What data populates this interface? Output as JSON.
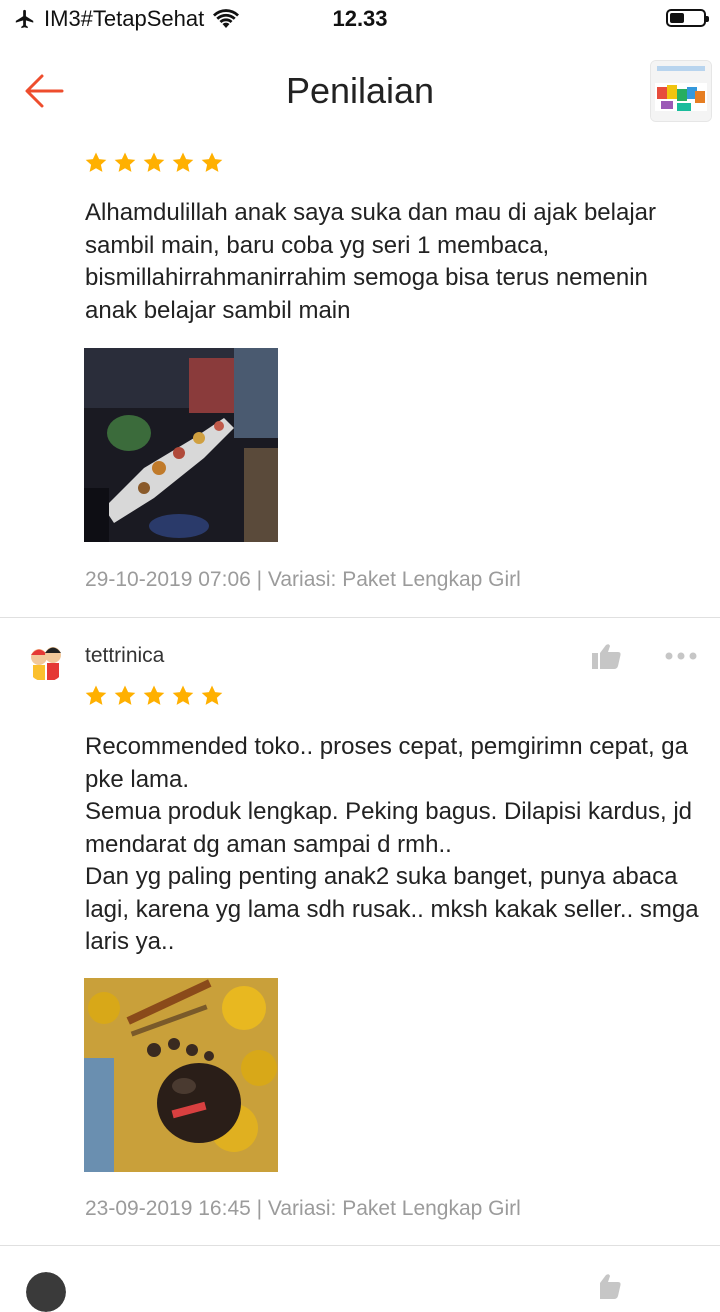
{
  "status_bar": {
    "carrier": "IM3#TetapSehat",
    "time": "12.33",
    "battery_fraction": 0.45
  },
  "header": {
    "title": "Penilaian",
    "back_icon": "arrow-left-icon",
    "accent_color": "#ee4d2d"
  },
  "colors": {
    "star": "#ffb000",
    "meta_text": "#9b9b9b",
    "icon_gray": "#c6c6c6"
  },
  "reviews": [
    {
      "rating": 5,
      "text": "Alhamdulillah anak saya suka dan mau di ajak belajar sambil main, baru coba yg seri 1 membaca, bismillahirrahmanirrahim semoga bisa terus nemenin anak belajar sambil main",
      "meta": "29-10-2019 07:06 | Variasi: Paket Lengkap Girl"
    },
    {
      "username": "tettrinica",
      "rating": 5,
      "text": "Recommended toko.. proses cepat, pemgirimn cepat, ga pke lama.\nSemua produk lengkap. Peking bagus. Dilapisi kardus, jd mendarat dg aman sampai d rmh..\nDan yg paling penting anak2 suka banget, punya abaca lagi, karena yg lama sdh rusak.. mksh kakak seller.. smga laris ya..",
      "meta": "23-09-2019 16:45 | Variasi: Paket Lengkap Girl"
    }
  ]
}
